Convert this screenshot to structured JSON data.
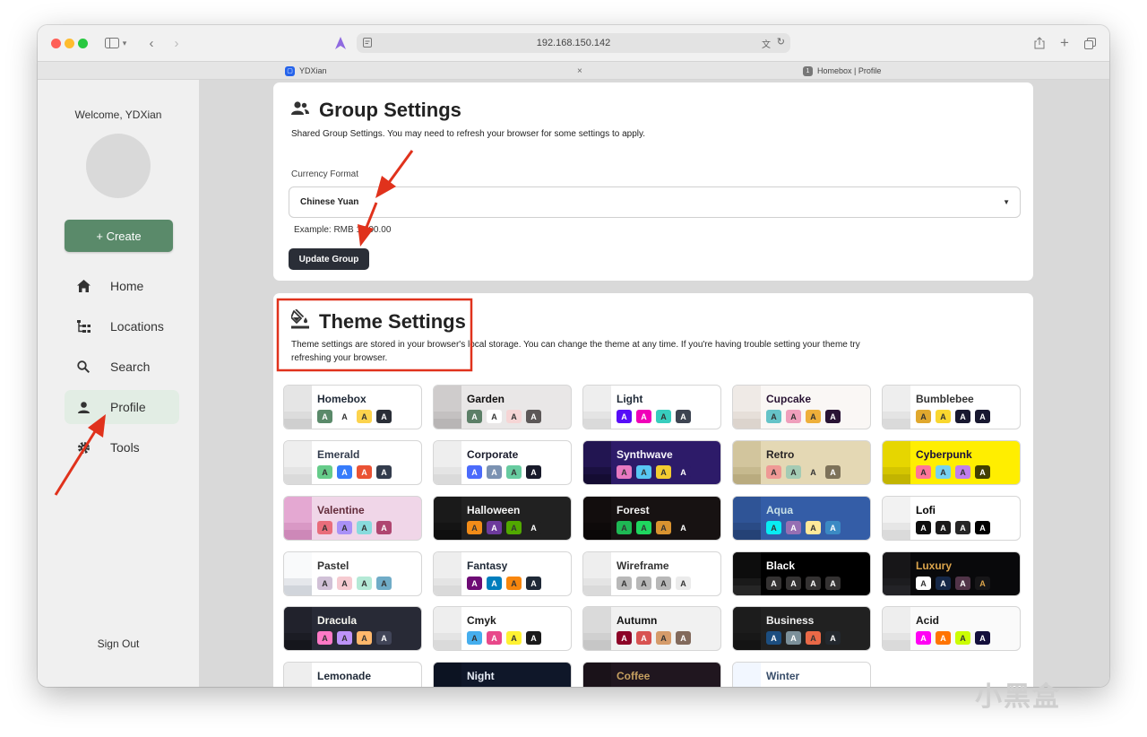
{
  "browser": {
    "url": "192.168.150.142",
    "tabs": [
      {
        "label": "YDXian"
      },
      {
        "label": "Homebox | Profile",
        "badge": "1"
      }
    ]
  },
  "sidebar": {
    "welcome": "Welcome, YDXian",
    "create_label": "+ Create",
    "nav": [
      {
        "label": "Home",
        "icon": "home-icon"
      },
      {
        "label": "Locations",
        "icon": "locations-icon"
      },
      {
        "label": "Search",
        "icon": "search-icon"
      },
      {
        "label": "Profile",
        "icon": "user-icon",
        "active": true
      },
      {
        "label": "Tools",
        "icon": "gear-icon"
      }
    ],
    "signout": "Sign Out"
  },
  "group_settings": {
    "title": "Group Settings",
    "description": "Shared Group Settings. You may need to refresh your browser for some settings to apply.",
    "currency_label": "Currency Format",
    "currency_value": "Chinese Yuan",
    "example": "Example: RMB 1,000.00",
    "update_button": "Update Group"
  },
  "theme_settings": {
    "title": "Theme Settings",
    "description": "Theme settings are stored in your browser's local storage. You can change the theme at any time. If you're having trouble setting your theme try refreshing your browser.",
    "themes": [
      {
        "name": "Homebox",
        "bg": "#ffffff",
        "fg": "#1f2937",
        "strip": [
          "#e5e5e5",
          "#dcdcdc",
          "#cfcfcf"
        ],
        "chips": [
          [
            "#5a8a6a",
            "#fff"
          ],
          [
            "#ffffff",
            "#333"
          ],
          [
            "#fcd34d",
            "#333"
          ],
          [
            "#2a2e37",
            "#fff"
          ]
        ]
      },
      {
        "name": "Garden",
        "bg": "#e9e7e7",
        "fg": "#100f0f",
        "strip": [
          "#cfcccc",
          "#c4c1c1",
          "#b8b5b5"
        ],
        "chips": [
          [
            "#5c7f67",
            "#fff"
          ],
          [
            "#ffffff",
            "#333"
          ],
          [
            "#f6d5d5",
            "#333"
          ],
          [
            "#5c5757",
            "#fff"
          ]
        ]
      },
      {
        "name": "Light",
        "bg": "#ffffff",
        "fg": "#1f2937",
        "strip": [
          "#eeeeee",
          "#e4e4e4",
          "#dadada"
        ],
        "chips": [
          [
            "#570df8",
            "#fff"
          ],
          [
            "#f000b8",
            "#fff"
          ],
          [
            "#37cdbe",
            "#333"
          ],
          [
            "#3d4451",
            "#fff"
          ]
        ]
      },
      {
        "name": "Cupcake",
        "bg": "#faf7f5",
        "fg": "#291334",
        "strip": [
          "#efeae6",
          "#e6dfd9",
          "#dcd4cd"
        ],
        "chips": [
          [
            "#65c3c8",
            "#333"
          ],
          [
            "#ef9fbc",
            "#333"
          ],
          [
            "#eeaf3a",
            "#333"
          ],
          [
            "#291334",
            "#fff"
          ]
        ]
      },
      {
        "name": "Bumblebee",
        "bg": "#ffffff",
        "fg": "#333333",
        "strip": [
          "#eeeeee",
          "#e4e4e4",
          "#dadada"
        ],
        "chips": [
          [
            "#e0a82e",
            "#333"
          ],
          [
            "#f9d72f",
            "#333"
          ],
          [
            "#181830",
            "#fff"
          ],
          [
            "#181830",
            "#fff"
          ]
        ]
      },
      {
        "name": "Emerald",
        "bg": "#ffffff",
        "fg": "#333c4d",
        "strip": [
          "#eeeeee",
          "#e4e4e4",
          "#dadada"
        ],
        "chips": [
          [
            "#66cc8a",
            "#333"
          ],
          [
            "#377cfb",
            "#fff"
          ],
          [
            "#ea5234",
            "#fff"
          ],
          [
            "#333c4d",
            "#fff"
          ]
        ]
      },
      {
        "name": "Corporate",
        "bg": "#ffffff",
        "fg": "#181a2a",
        "strip": [
          "#eeeeee",
          "#e4e4e4",
          "#dadada"
        ],
        "chips": [
          [
            "#4b6bfb",
            "#fff"
          ],
          [
            "#7b92b2",
            "#fff"
          ],
          [
            "#67cba0",
            "#333"
          ],
          [
            "#181a2a",
            "#fff"
          ]
        ]
      },
      {
        "name": "Synthwave",
        "bg": "#2d1b69",
        "fg": "#f9f7fd",
        "strip": [
          "#221551",
          "#1a1040",
          "#140c32"
        ],
        "chips": [
          [
            "#e779c1",
            "#333"
          ],
          [
            "#58c7f3",
            "#333"
          ],
          [
            "#f3cc30",
            "#333"
          ],
          [
            "#2d1b69",
            "#fff"
          ]
        ]
      },
      {
        "name": "Retro",
        "bg": "#e4d8b4",
        "fg": "#282425",
        "strip": [
          "#d2c59d",
          "#c6b98e",
          "#b9ab7f"
        ],
        "chips": [
          [
            "#ef9995",
            "#333"
          ],
          [
            "#a4cbb4",
            "#333"
          ],
          [
            "#e4d8b4",
            "#333"
          ],
          [
            "#7d7259",
            "#fff"
          ]
        ]
      },
      {
        "name": "Cyberpunk",
        "bg": "#ffee00",
        "fg": "#1a103d",
        "strip": [
          "#e6d600",
          "#d4c500",
          "#c2b400"
        ],
        "chips": [
          [
            "#ff7598",
            "#333"
          ],
          [
            "#75d1f0",
            "#333"
          ],
          [
            "#c07eec",
            "#333"
          ],
          [
            "#423f00",
            "#fff"
          ]
        ]
      },
      {
        "name": "Valentine",
        "bg": "#f0d6e8",
        "fg": "#632c3b",
        "strip": [
          "#e4a8d2",
          "#d998c5",
          "#cd88b8"
        ],
        "chips": [
          [
            "#e96d7b",
            "#333"
          ],
          [
            "#a991f7",
            "#333"
          ],
          [
            "#88dbdd",
            "#333"
          ],
          [
            "#af4670",
            "#fff"
          ]
        ]
      },
      {
        "name": "Halloween",
        "bg": "#212121",
        "fg": "#f5f5f5",
        "strip": [
          "#1a1a1a",
          "#141414",
          "#0f0f0f"
        ],
        "chips": [
          [
            "#f28c18",
            "#333"
          ],
          [
            "#6d3a9c",
            "#fff"
          ],
          [
            "#51a800",
            "#333"
          ],
          [
            "#212121",
            "#fff"
          ]
        ]
      },
      {
        "name": "Forest",
        "bg": "#171212",
        "fg": "#f2f2f2",
        "strip": [
          "#120d0d",
          "#0e0a0a",
          "#0a0707"
        ],
        "chips": [
          [
            "#1eb854",
            "#333"
          ],
          [
            "#1fd65f",
            "#333"
          ],
          [
            "#d99330",
            "#333"
          ],
          [
            "#171212",
            "#fff"
          ]
        ]
      },
      {
        "name": "Aqua",
        "bg": "#345da7",
        "fg": "#c8e1e7",
        "strip": [
          "#2f5496",
          "#2a4b86",
          "#254276"
        ],
        "chips": [
          [
            "#09ecf3",
            "#333"
          ],
          [
            "#966fb3",
            "#fff"
          ],
          [
            "#ffe999",
            "#333"
          ],
          [
            "#3b8ac4",
            "#fff"
          ]
        ]
      },
      {
        "name": "Lofi",
        "bg": "#ffffff",
        "fg": "#000000",
        "strip": [
          "#f2f2f2",
          "#e6e6e6",
          "#dadada"
        ],
        "chips": [
          [
            "#0d0d0d",
            "#fff"
          ],
          [
            "#1a1919",
            "#fff"
          ],
          [
            "#262626",
            "#fff"
          ],
          [
            "#000000",
            "#fff"
          ]
        ]
      },
      {
        "name": "Pastel",
        "bg": "#ffffff",
        "fg": "#333333",
        "strip": [
          "#f9fafb",
          "#e5e7eb",
          "#d1d5db"
        ],
        "chips": [
          [
            "#d1c1d7",
            "#333"
          ],
          [
            "#f6cbd1",
            "#333"
          ],
          [
            "#b4e9d6",
            "#333"
          ],
          [
            "#70acc7",
            "#333"
          ]
        ]
      },
      {
        "name": "Fantasy",
        "bg": "#ffffff",
        "fg": "#1f2937",
        "strip": [
          "#eeeeee",
          "#e4e4e4",
          "#dadada"
        ],
        "chips": [
          [
            "#6e0b75",
            "#fff"
          ],
          [
            "#007ebd",
            "#fff"
          ],
          [
            "#f8860d",
            "#333"
          ],
          [
            "#1f2937",
            "#fff"
          ]
        ]
      },
      {
        "name": "Wireframe",
        "bg": "#ffffff",
        "fg": "#333333",
        "strip": [
          "#eeeeee",
          "#e4e4e4",
          "#dadada"
        ],
        "chips": [
          [
            "#b8b8b8",
            "#333"
          ],
          [
            "#b8b8b8",
            "#333"
          ],
          [
            "#b8b8b8",
            "#333"
          ],
          [
            "#ebebeb",
            "#333"
          ]
        ]
      },
      {
        "name": "Black",
        "bg": "#000000",
        "fg": "#ffffff",
        "strip": [
          "#0d0d0d",
          "#1a1a1a",
          "#262626"
        ],
        "chips": [
          [
            "#343232",
            "#fff"
          ],
          [
            "#343232",
            "#fff"
          ],
          [
            "#343232",
            "#fff"
          ],
          [
            "#343232",
            "#fff"
          ]
        ]
      },
      {
        "name": "Luxury",
        "bg": "#09090b",
        "fg": "#dca54c",
        "strip": [
          "#171618",
          "#1c1c1f",
          "#232327"
        ],
        "chips": [
          [
            "#ffffff",
            "#333"
          ],
          [
            "#152747",
            "#fff"
          ],
          [
            "#513448",
            "#fff"
          ],
          [
            "#171618",
            "#dca54c"
          ]
        ]
      },
      {
        "name": "Dracula",
        "bg": "#282a36",
        "fg": "#f8f8f2",
        "strip": [
          "#21222c",
          "#1b1c24",
          "#15161c"
        ],
        "chips": [
          [
            "#ff79c6",
            "#333"
          ],
          [
            "#bd93f9",
            "#333"
          ],
          [
            "#ffb86c",
            "#333"
          ],
          [
            "#414558",
            "#fff"
          ]
        ]
      },
      {
        "name": "Cmyk",
        "bg": "#ffffff",
        "fg": "#1a1a1a",
        "strip": [
          "#eeeeee",
          "#e4e4e4",
          "#dadada"
        ],
        "chips": [
          [
            "#45aeee",
            "#333"
          ],
          [
            "#e8488a",
            "#fff"
          ],
          [
            "#fff232",
            "#333"
          ],
          [
            "#1a1a1a",
            "#fff"
          ]
        ]
      },
      {
        "name": "Autumn",
        "bg": "#f1f1f1",
        "fg": "#141414",
        "strip": [
          "#dadada",
          "#d0d0d0",
          "#c6c6c6"
        ],
        "chips": [
          [
            "#8c0327",
            "#fff"
          ],
          [
            "#d85251",
            "#fff"
          ],
          [
            "#d59b6a",
            "#333"
          ],
          [
            "#826a5c",
            "#fff"
          ]
        ]
      },
      {
        "name": "Business",
        "bg": "#212121",
        "fg": "#f0f0f0",
        "strip": [
          "#1c1c1c",
          "#181818",
          "#141414"
        ],
        "chips": [
          [
            "#1c4e80",
            "#fff"
          ],
          [
            "#7c909a",
            "#fff"
          ],
          [
            "#ea6947",
            "#333"
          ],
          [
            "#23282e",
            "#fff"
          ]
        ]
      },
      {
        "name": "Acid",
        "bg": "#fafafa",
        "fg": "#1a1a1a",
        "strip": [
          "#eeeeee",
          "#e4e4e4",
          "#dadada"
        ],
        "chips": [
          [
            "#ff00f4",
            "#fff"
          ],
          [
            "#ff7400",
            "#fff"
          ],
          [
            "#cbfd03",
            "#333"
          ],
          [
            "#140f3c",
            "#fff"
          ]
        ]
      },
      {
        "name": "Lemonade",
        "bg": "#ffffff",
        "fg": "#1f2937",
        "strip": [
          "#eeeeee",
          "#e4e4e4",
          "#dadada"
        ],
        "chips": [
          [
            "#519903",
            "#fff"
          ],
          [
            "#e9e92e",
            "#333"
          ],
          [
            "#f7f9ca",
            "#333"
          ],
          [
            "#191a3f",
            "#fff"
          ]
        ]
      },
      {
        "name": "Night",
        "bg": "#0f1729",
        "fg": "#e6ecf5",
        "strip": [
          "#0c1322",
          "#0a0f1b",
          "#070b15"
        ],
        "chips": [
          [
            "#38bdf8",
            "#333"
          ],
          [
            "#818cf8",
            "#333"
          ],
          [
            "#f471b5",
            "#333"
          ],
          [
            "#1e293b",
            "#fff"
          ]
        ]
      },
      {
        "name": "Coffee",
        "bg": "#20161f",
        "fg": "#c59f60",
        "strip": [
          "#1a1219",
          "#150f14",
          "#100b10"
        ],
        "chips": [
          [
            "#db924b",
            "#333"
          ],
          [
            "#263e3f",
            "#fff"
          ],
          [
            "#10576d",
            "#fff"
          ],
          [
            "#20161f",
            "#c59f60"
          ]
        ]
      },
      {
        "name": "Winter",
        "bg": "#ffffff",
        "fg": "#394e6a",
        "strip": [
          "#f2f7ff",
          "#e3e9f4",
          "#d3dbe9"
        ],
        "chips": [
          [
            "#047aff",
            "#fff"
          ],
          [
            "#463aa2",
            "#fff"
          ],
          [
            "#c148ac",
            "#fff"
          ],
          [
            "#021431",
            "#fff"
          ]
        ]
      }
    ]
  },
  "watermark": "小黑盒"
}
